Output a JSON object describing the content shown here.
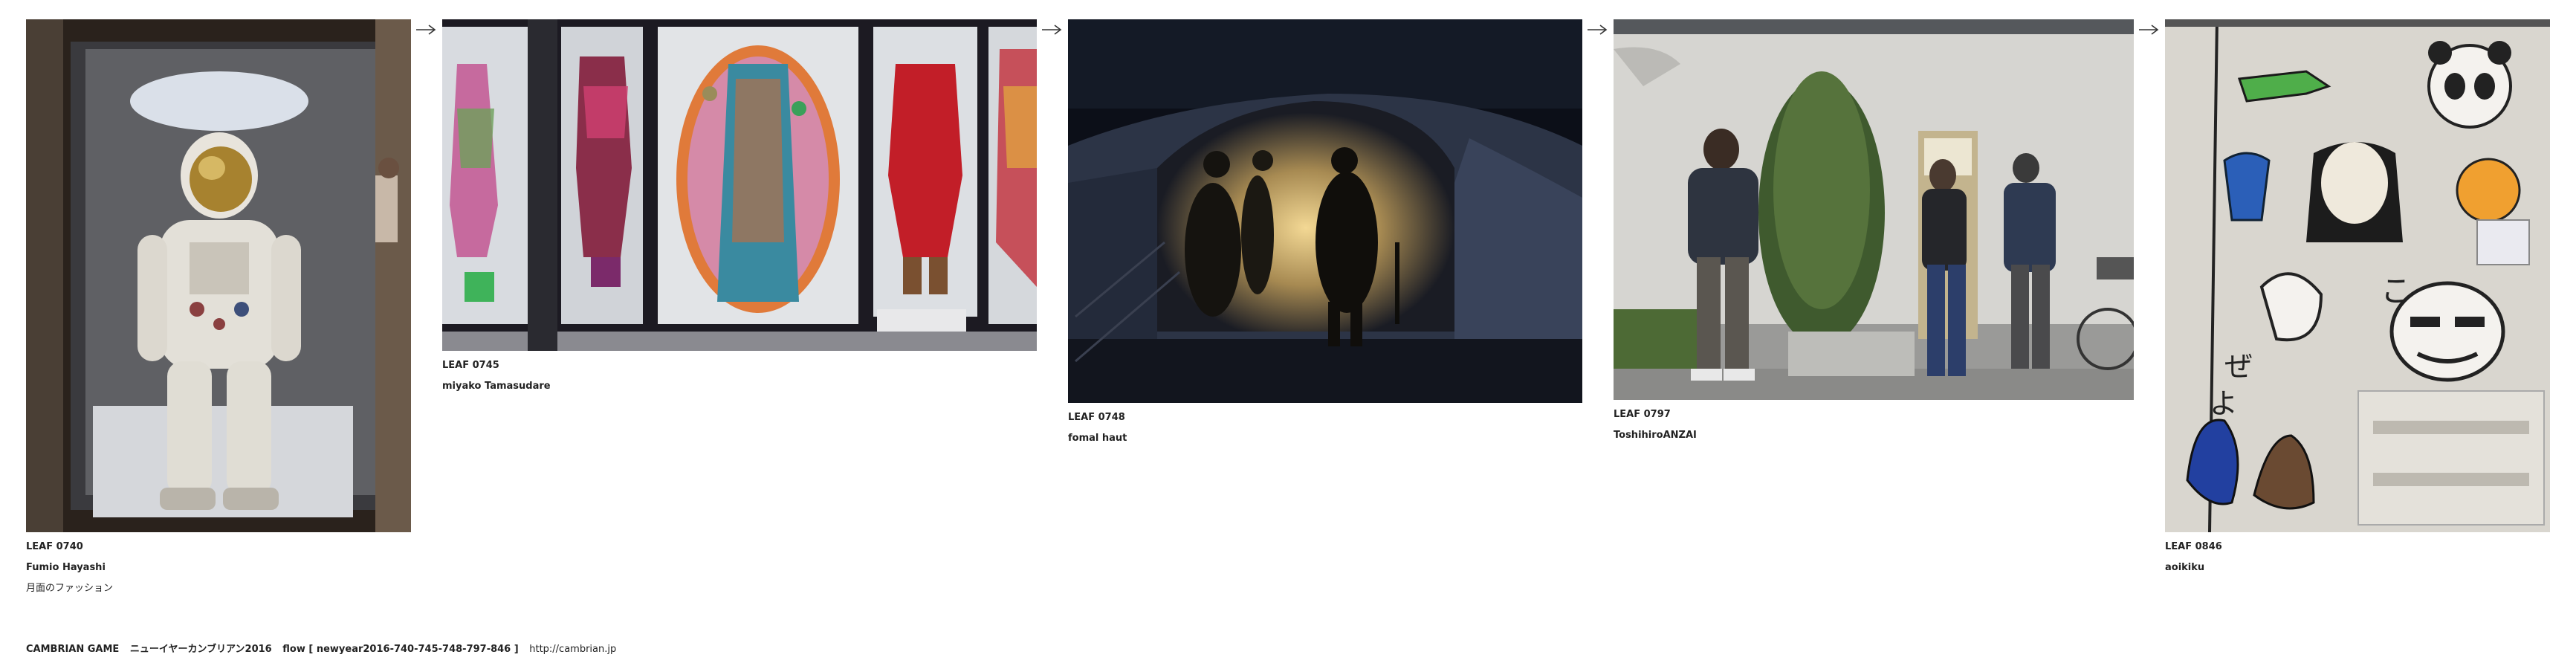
{
  "leaves": [
    {
      "id": "LEAF 0740",
      "author": "Fumio Hayashi",
      "title": "月面のファッション",
      "photo": "astronaut-spacesuit-photo"
    },
    {
      "id": "LEAF 0745",
      "author": "miyako Tamasudare",
      "title": "",
      "photo": "costume-exhibit-photo"
    },
    {
      "id": "LEAF 0748",
      "author": "fomal haut",
      "title": "",
      "photo": "snow-tunnel-photo"
    },
    {
      "id": "LEAF 0797",
      "author": "ToshihiroANZAI",
      "title": "",
      "photo": "street-people-photo"
    },
    {
      "id": "LEAF 0846",
      "author": "aoikiku",
      "title": "",
      "photo": "sticker-wall-photo"
    }
  ],
  "arrow_glyph": "→",
  "footer": {
    "brand": "CAMBRIAN GAME",
    "event": "ニューイヤーカンブリアン2016",
    "flow": "flow [ newyear2016-740-745-748-797-846 ]",
    "url": "http://cambrian.jp"
  },
  "colors": {
    "text": "#222222",
    "background": "#ffffff"
  }
}
